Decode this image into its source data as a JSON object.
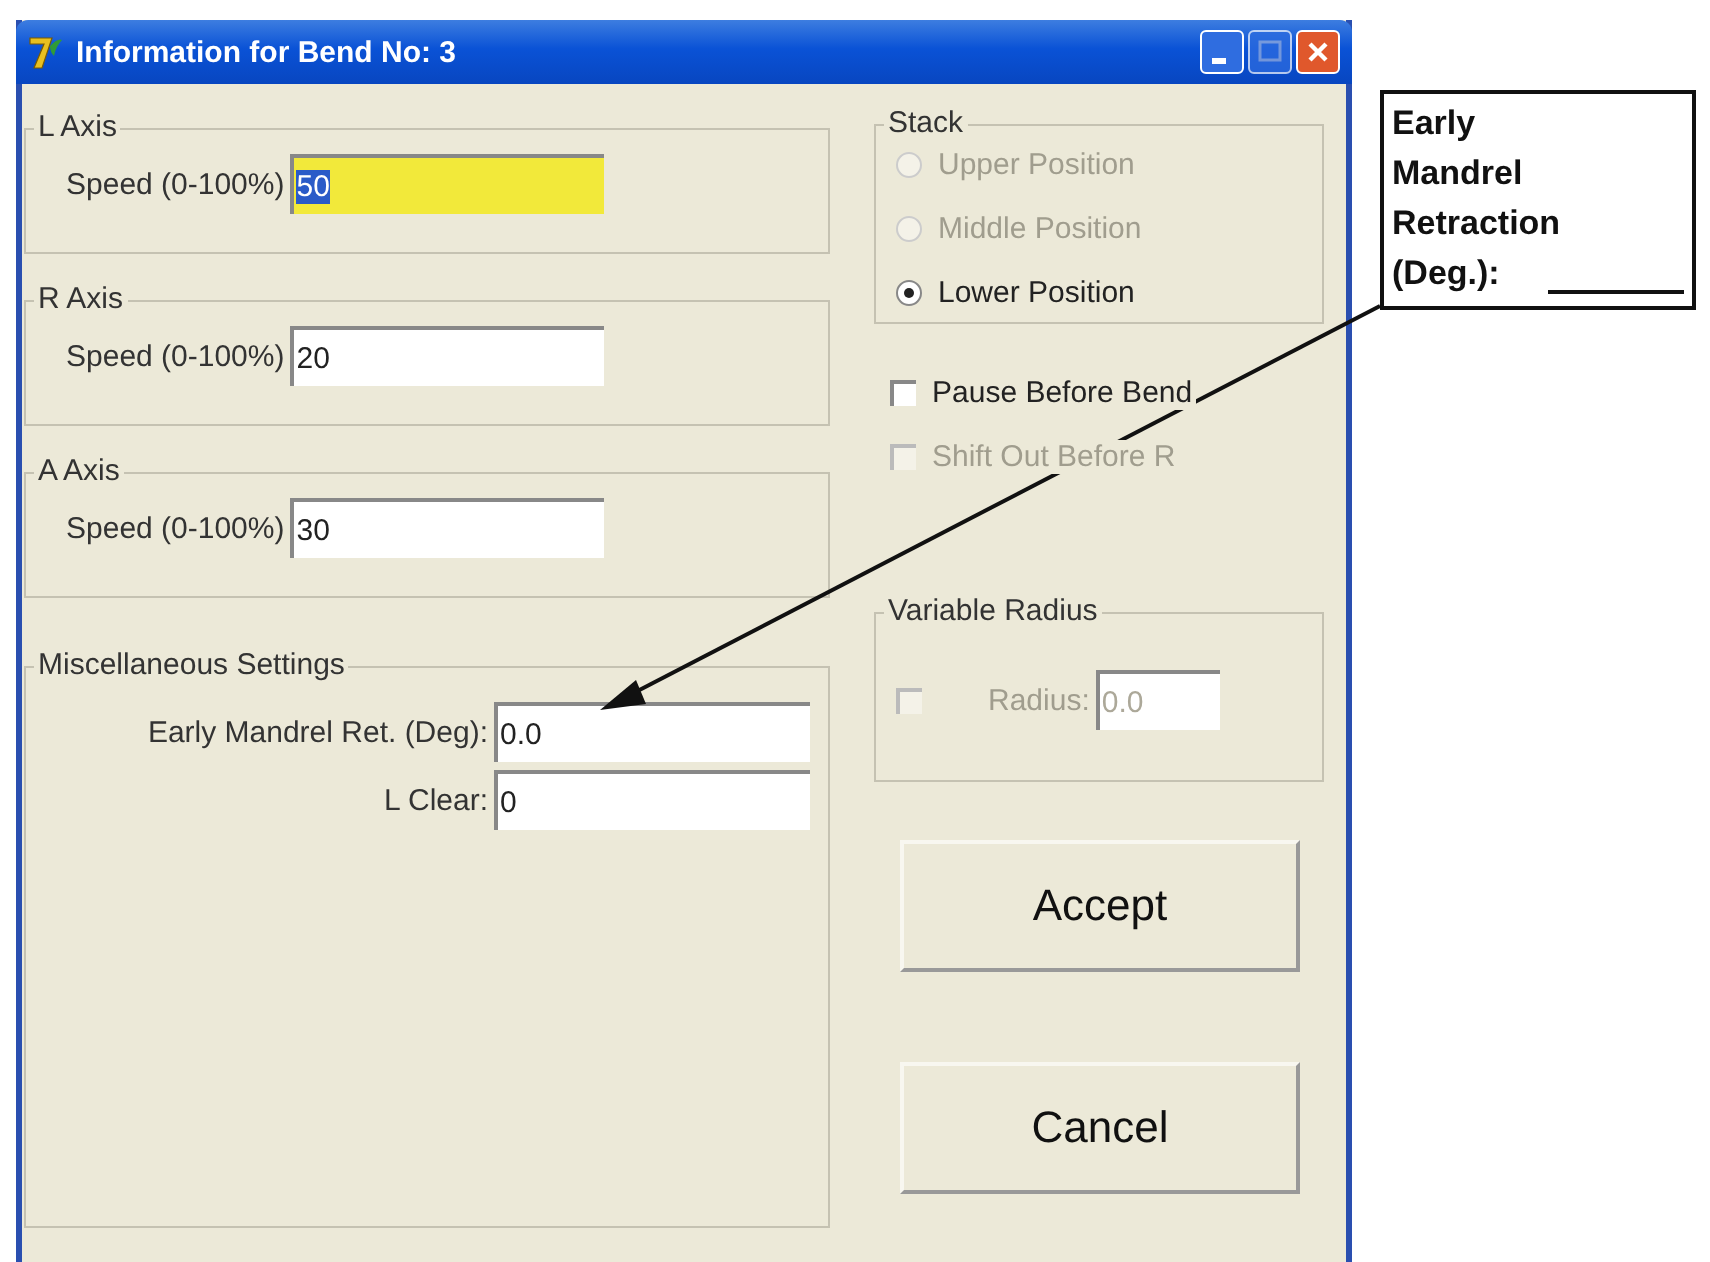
{
  "window": {
    "title": "Information for Bend No: 3"
  },
  "axes": [
    {
      "title": "L Axis",
      "label": "Speed (0-100%)",
      "value": "50",
      "focused": true
    },
    {
      "title": "R Axis",
      "label": "Speed (0-100%)",
      "value": "20",
      "focused": false
    },
    {
      "title": "A Axis",
      "label": "Speed (0-100%)",
      "value": "30",
      "focused": false
    }
  ],
  "stack": {
    "title": "Stack",
    "options": [
      {
        "label": "Upper Position",
        "selected": false,
        "disabled": true
      },
      {
        "label": "Middle Position",
        "selected": false,
        "disabled": true
      },
      {
        "label": "Lower Position",
        "selected": true,
        "disabled": false
      }
    ]
  },
  "checkboxes": [
    {
      "label": "Pause Before Bend",
      "checked": false,
      "disabled": false
    },
    {
      "label": "Shift Out Before R",
      "checked": false,
      "disabled": true
    }
  ],
  "misc": {
    "title": "Miscellaneous Settings",
    "fields": [
      {
        "label": "Early Mandrel Ret. (Deg):",
        "value": "0.0"
      },
      {
        "label": "L Clear:",
        "value": "0"
      }
    ]
  },
  "variable_radius": {
    "title": "Variable Radius",
    "checked": false,
    "disabled": true,
    "label": "Radius:",
    "value": "0.0"
  },
  "buttons": [
    "Accept",
    "Cancel"
  ],
  "callout": {
    "lines": [
      "Early",
      "Mandrel",
      "Retraction",
      "(Deg.):"
    ]
  }
}
